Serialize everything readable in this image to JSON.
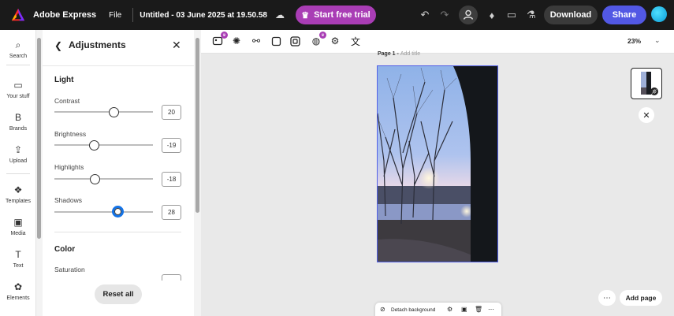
{
  "topbar": {
    "app_name": "Adobe Express",
    "file_menu": "File",
    "doc_title": "Untitled - 03 June 2025 at 19.50.58",
    "trial_label": "Start free trial",
    "download_label": "Download",
    "share_label": "Share"
  },
  "rail": {
    "items": [
      {
        "label": "Search",
        "icon": "search-icon"
      },
      {
        "label": "Your stuff",
        "icon": "folder-icon"
      },
      {
        "label": "Brands",
        "icon": "brand-icon"
      },
      {
        "label": "Upload",
        "icon": "upload-icon"
      },
      {
        "label": "Templates",
        "icon": "templates-icon"
      },
      {
        "label": "Media",
        "icon": "media-icon"
      },
      {
        "label": "Text",
        "icon": "text-icon"
      },
      {
        "label": "Elements",
        "icon": "elements-icon"
      }
    ]
  },
  "panel": {
    "title": "Adjustments",
    "light_title": "Light",
    "color_title": "Color",
    "sliders": [
      {
        "label": "Contrast",
        "value": "20",
        "level": 0.6
      },
      {
        "label": "Brightness",
        "value": "-19",
        "level": 0.405
      },
      {
        "label": "Highlights",
        "value": "-18",
        "level": 0.41
      },
      {
        "label": "Shadows",
        "value": "28",
        "level": 0.64
      }
    ],
    "saturation_label": "Saturation",
    "reset_label": "Reset all"
  },
  "canvas": {
    "zoom": "23%",
    "page_label": "Page 1 -",
    "page_title_placeholder": "Add title",
    "detach_label": "Detach background",
    "add_page_label": "Add page"
  },
  "colors": {
    "accent": "#5258e4",
    "trial": "#a93db5",
    "slider_active": "#1473e6"
  }
}
